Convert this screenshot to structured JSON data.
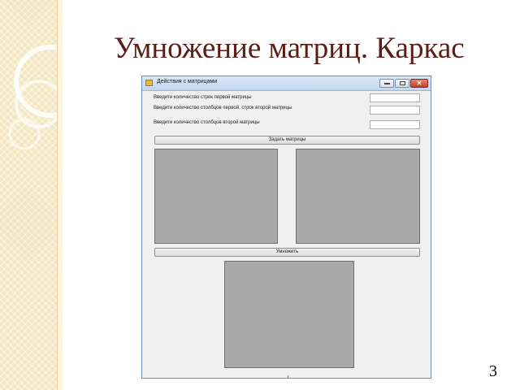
{
  "slide": {
    "title": "Умножение матриц. Каркас",
    "page_number": "3"
  },
  "window": {
    "title": "Действия с матрицами",
    "controls": {
      "minimize": "–",
      "maximize": "□",
      "close": "✕"
    }
  },
  "form": {
    "rows_first_label": "Введите количество строк первой матрицы",
    "rows_first_value": "",
    "cols_first_rows_second_label": "Введите количество столбцов первой, строк второй матрицы",
    "cols_first_rows_second_value": "",
    "cols_second_label": "Введите количество столбцов второй матрицы",
    "cols_second_value": "",
    "set_matrices_button": "Задать матрицы",
    "multiply_button": "Умножить"
  },
  "icons": {
    "app": "app-icon",
    "minimize": "minimize-icon",
    "maximize": "maximize-icon",
    "close": "close-icon"
  },
  "colors": {
    "title_color": "#5b1d16",
    "grid_fill": "#a9a9a9",
    "window_bg": "#f0f0f0"
  }
}
